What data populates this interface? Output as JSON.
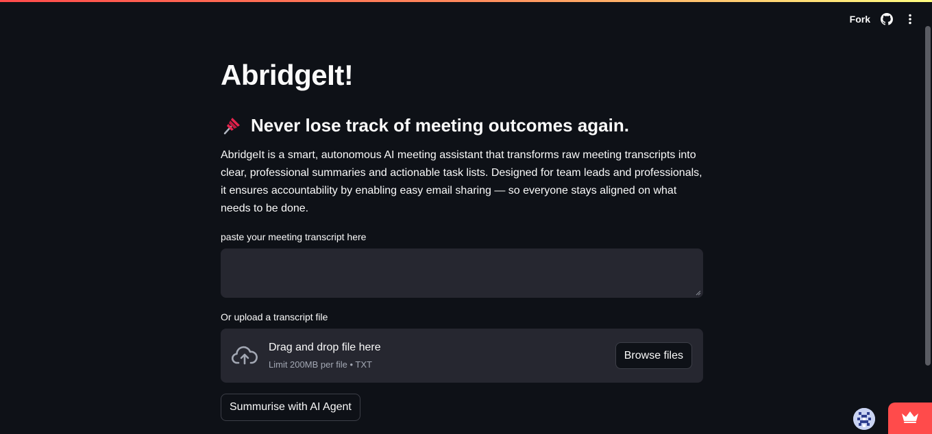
{
  "toolbar": {
    "fork_label": "Fork",
    "github_icon": "github-icon",
    "menu_icon": "vertical-dots-icon"
  },
  "main": {
    "title": "AbridgeIt!",
    "subtitle": "Never lose track of meeting outcomes again.",
    "subtitle_icon": "pushpin-icon",
    "description": "AbridgeIt is a smart, autonomous AI meeting assistant that transforms raw meeting transcripts into clear, professional summaries and actionable task lists. Designed for team leads and professionals, it ensures accountability by enabling easy email sharing — so everyone stays aligned on what needs to be done.",
    "transcript_label": "paste your meeting transcript here",
    "transcript_value": "",
    "upload_label": "Or upload a transcript file",
    "dropzone": {
      "title": "Drag and drop file here",
      "limit": "Limit 200MB per file • TXT",
      "icon": "cloud-upload-icon"
    },
    "browse_label": "Browse files",
    "summarise_label": "Summurise with AI Agent"
  },
  "colors": {
    "background": "#0e1117",
    "input_bg": "#262730",
    "accent": "#ff4b4b"
  }
}
